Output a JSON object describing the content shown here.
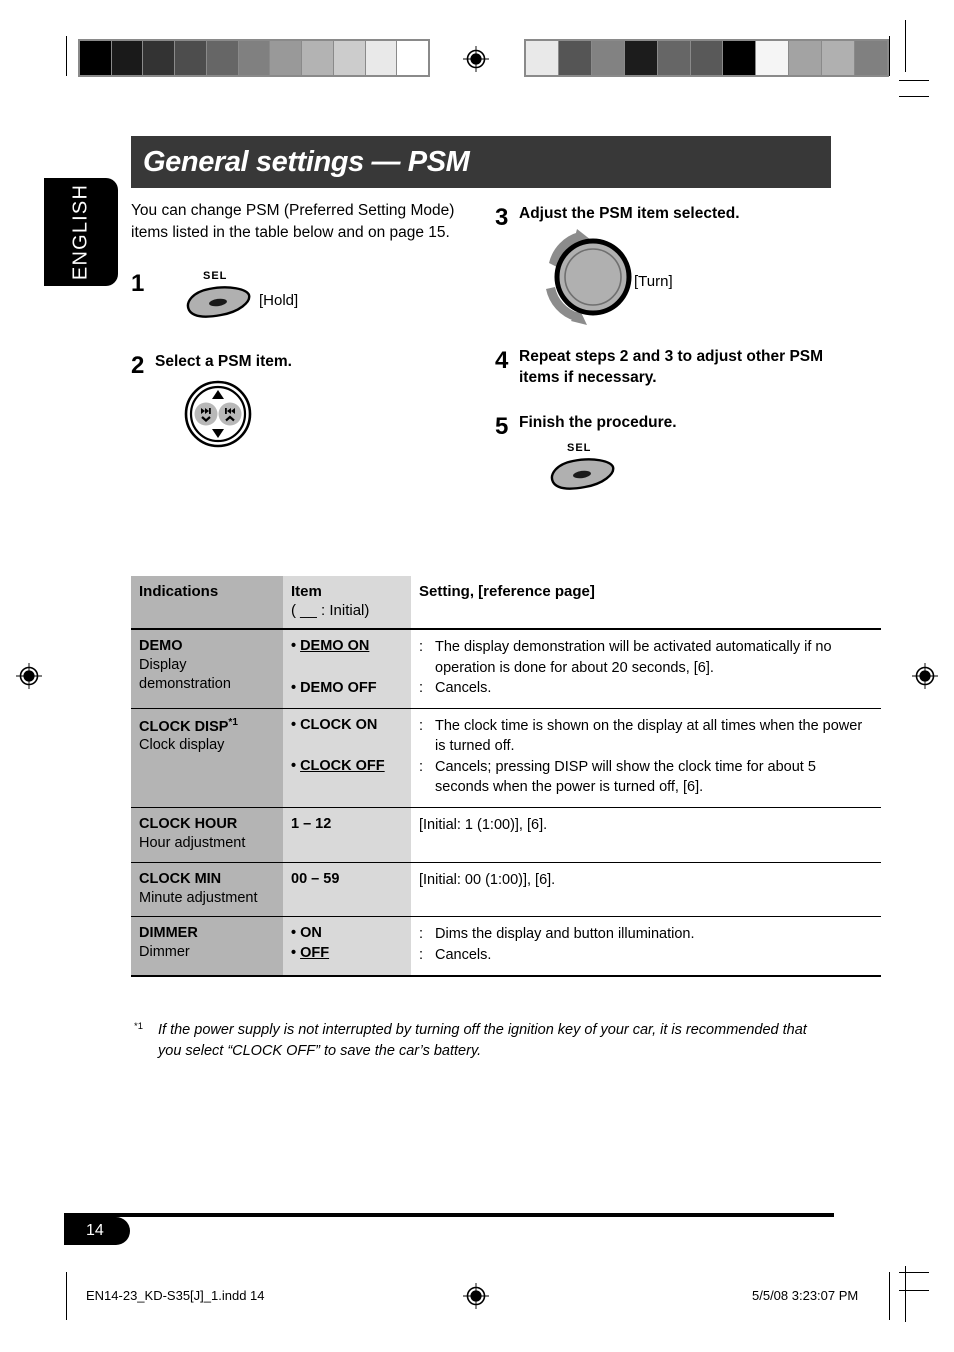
{
  "language_tab": {
    "label": "ENGLISH"
  },
  "header": {
    "title": "General settings — PSM"
  },
  "intro": {
    "text": "You can change PSM (Preferred Setting Mode) items listed in the table below and on page 15."
  },
  "steps": [
    {
      "num": "1",
      "title": "",
      "icon": "sel-button-icon",
      "icon_label": "SEL",
      "tag": "[Hold]"
    },
    {
      "num": "2",
      "title": "Select a PSM item.",
      "icon": "navigation-pad-icon",
      "icon_label": "",
      "tag": ""
    },
    {
      "num": "3",
      "title": "Adjust the PSM item selected.",
      "icon": "rotary-knob-icon",
      "icon_label": "",
      "tag": "[Turn]"
    },
    {
      "num": "4",
      "title": "Repeat steps 2 and 3 to adjust other PSM items if necessary.",
      "icon": "",
      "icon_label": "",
      "tag": ""
    },
    {
      "num": "5",
      "title": "Finish the procedure.",
      "icon": "sel-button-icon",
      "icon_label": "SEL",
      "tag": ""
    }
  ],
  "table": {
    "headers": {
      "indications": "Indications",
      "item_main": "Item",
      "item_sub": "( __ : Initial)",
      "setting": "Setting, [reference page]"
    },
    "rows": [
      {
        "indication_name": "DEMO",
        "indication_sup": "",
        "indication_desc": "Display\ndemonstration",
        "options": [
          {
            "bullet": "•",
            "label": "DEMO ON",
            "underlined": true,
            "spaced": false
          },
          {
            "bullet": "•",
            "label": "DEMO OFF",
            "underlined": false,
            "spaced": true
          }
        ],
        "settings": [
          {
            "colon": ":",
            "text": "The display demonstration will be activated automatically if no operation is done for about 20 seconds, [6].",
            "gap": false
          },
          {
            "colon": ":",
            "text": "Cancels.",
            "gap": false
          }
        ]
      },
      {
        "indication_name": "CLOCK DISP",
        "indication_sup": "*1",
        "indication_desc": "Clock display",
        "options": [
          {
            "bullet": "•",
            "label": "CLOCK ON",
            "underlined": false,
            "spaced": false
          },
          {
            "bullet": "•",
            "label": "CLOCK OFF",
            "underlined": true,
            "spaced": true
          }
        ],
        "settings": [
          {
            "colon": ":",
            "text": "The clock time is shown on the display at all times when the power is turned off.",
            "gap": false
          },
          {
            "colon": ":",
            "text": "Cancels; pressing DISP will show the clock time for about 5 seconds when the power is turned off, [6].",
            "gap": false
          }
        ]
      },
      {
        "indication_name": "CLOCK HOUR",
        "indication_sup": "",
        "indication_desc": "Hour adjustment",
        "range": "1 – 12",
        "plain_setting": "[Initial: 1 (1:00)], [6]."
      },
      {
        "indication_name": "CLOCK MIN",
        "indication_sup": "",
        "indication_desc": "Minute adjustment",
        "range": "00 – 59",
        "plain_setting": "[Initial: 00 (1:00)], [6]."
      },
      {
        "indication_name": "DIMMER",
        "indication_sup": "",
        "indication_desc": "Dimmer",
        "options": [
          {
            "bullet": "•",
            "label": "ON",
            "underlined": false,
            "spaced": false
          },
          {
            "bullet": "•",
            "label": "OFF",
            "underlined": true,
            "spaced": false
          }
        ],
        "settings": [
          {
            "colon": ":",
            "text": "Dims the display and button illumination.",
            "gap": false
          },
          {
            "colon": ":",
            "text": "Cancels.",
            "gap": false
          }
        ]
      }
    ]
  },
  "footnote": {
    "mark": "*1",
    "text": "If the power supply is not interrupted by turning off the ignition key of your car, it is recommended that you select “CLOCK OFF” to save the car’s battery."
  },
  "footer": {
    "page_number": "14",
    "file_name": "EN14-23_KD-S35[J]_1.indd   14",
    "print_stamp": "5/5/08   3:23:07 PM"
  },
  "colorbars": {
    "left": [
      "#000000",
      "#1a1a1a",
      "#333333",
      "#4d4d4d",
      "#666666",
      "#808080",
      "#999999",
      "#b3b3b3",
      "#cccccc",
      "#e9e9e9",
      "#ffffff"
    ],
    "right": [
      "#e9e9e9",
      "#555555",
      "#828282",
      "#1c1c1c",
      "#666666",
      "#595959",
      "#000000",
      "#f5f5f5",
      "#a3a3a3",
      "#b0b0b0",
      "#808080"
    ]
  }
}
